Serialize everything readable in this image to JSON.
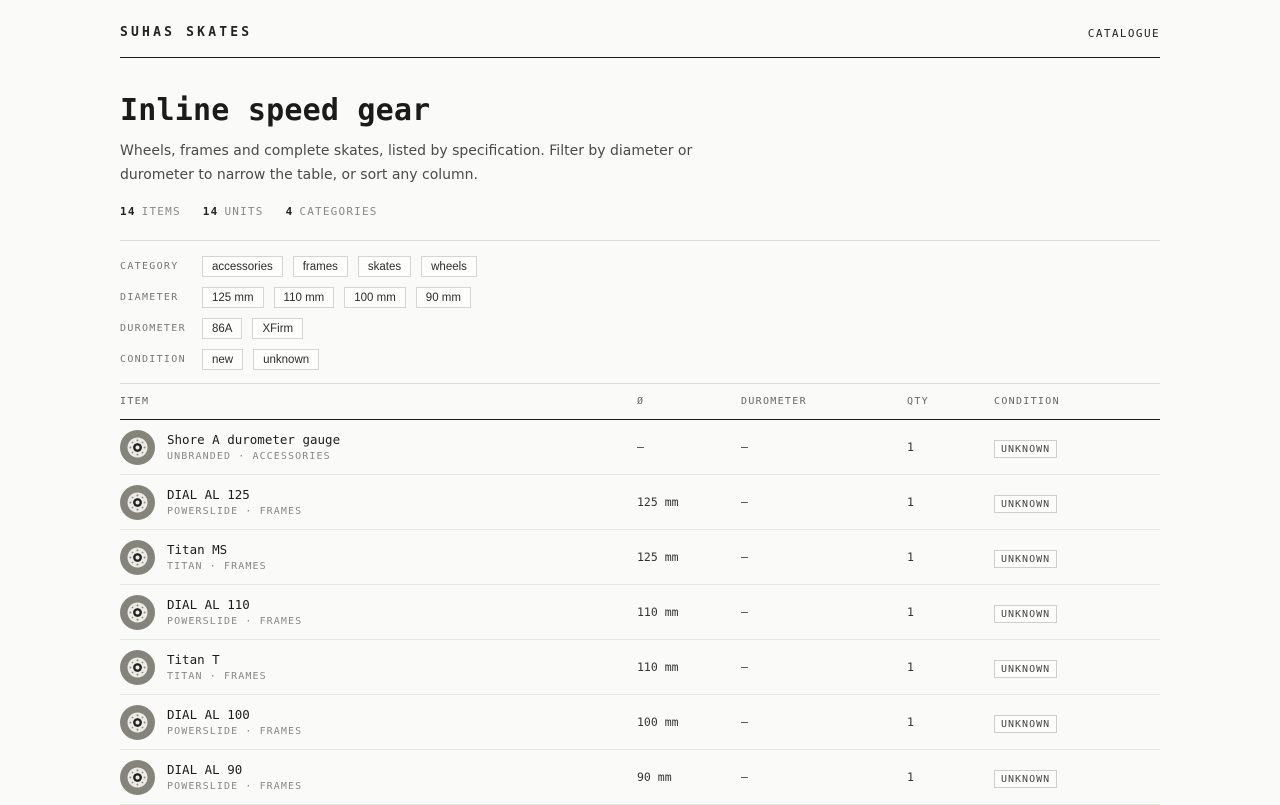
{
  "header": {
    "brand": "SUHAS SKATES",
    "nav_catalogue": "CATALOGUE"
  },
  "hero": {
    "title": "Inline speed gear",
    "intro": "Wheels, frames and complete skates, listed by specification. Filter by diameter or durometer to narrow the table, or sort any column."
  },
  "stats": [
    {
      "value": "14",
      "label": "ITEMS"
    },
    {
      "value": "14",
      "label": "UNITS"
    },
    {
      "value": "4",
      "label": "CATEGORIES"
    }
  ],
  "filters": [
    {
      "label": "CATEGORY",
      "options": [
        "accessories",
        "frames",
        "skates",
        "wheels"
      ]
    },
    {
      "label": "DIAMETER",
      "options": [
        "125 mm",
        "110 mm",
        "100 mm",
        "90 mm"
      ]
    },
    {
      "label": "DUROMETER",
      "options": [
        "86A",
        "XFirm"
      ]
    },
    {
      "label": "CONDITION",
      "options": [
        "new",
        "unknown"
      ]
    }
  ],
  "table": {
    "columns": {
      "item": "ITEM",
      "diameter": "Ø",
      "durometer": "DUROMETER",
      "qty": "QTY",
      "condition": "CONDITION"
    },
    "rows": [
      {
        "name": "Shore A durometer gauge",
        "meta": "UNBRANDED · ACCESSORIES",
        "diameter": "—",
        "durometer": "—",
        "qty": "1",
        "condition": "UNKNOWN"
      },
      {
        "name": "DIAL AL 125",
        "meta": "POWERSLIDE · FRAMES",
        "diameter": "125 mm",
        "durometer": "—",
        "qty": "1",
        "condition": "UNKNOWN"
      },
      {
        "name": "Titan MS",
        "meta": "TITAN · FRAMES",
        "diameter": "125 mm",
        "durometer": "—",
        "qty": "1",
        "condition": "UNKNOWN"
      },
      {
        "name": "DIAL AL 110",
        "meta": "POWERSLIDE · FRAMES",
        "diameter": "110 mm",
        "durometer": "—",
        "qty": "1",
        "condition": "UNKNOWN"
      },
      {
        "name": "Titan T",
        "meta": "TITAN · FRAMES",
        "diameter": "110 mm",
        "durometer": "—",
        "qty": "1",
        "condition": "UNKNOWN"
      },
      {
        "name": "DIAL AL 100",
        "meta": "POWERSLIDE · FRAMES",
        "diameter": "100 mm",
        "durometer": "—",
        "qty": "1",
        "condition": "UNKNOWN"
      },
      {
        "name": "DIAL AL 90",
        "meta": "POWERSLIDE · FRAMES",
        "diameter": "90 mm",
        "durometer": "—",
        "qty": "1",
        "condition": "UNKNOWN"
      }
    ]
  },
  "colors": {
    "background": "#fafaf8",
    "ink": "#1b1b1b",
    "muted": "#888888",
    "thumb": "#85847b"
  },
  "icons": {
    "row_thumb": "wheel-icon"
  }
}
